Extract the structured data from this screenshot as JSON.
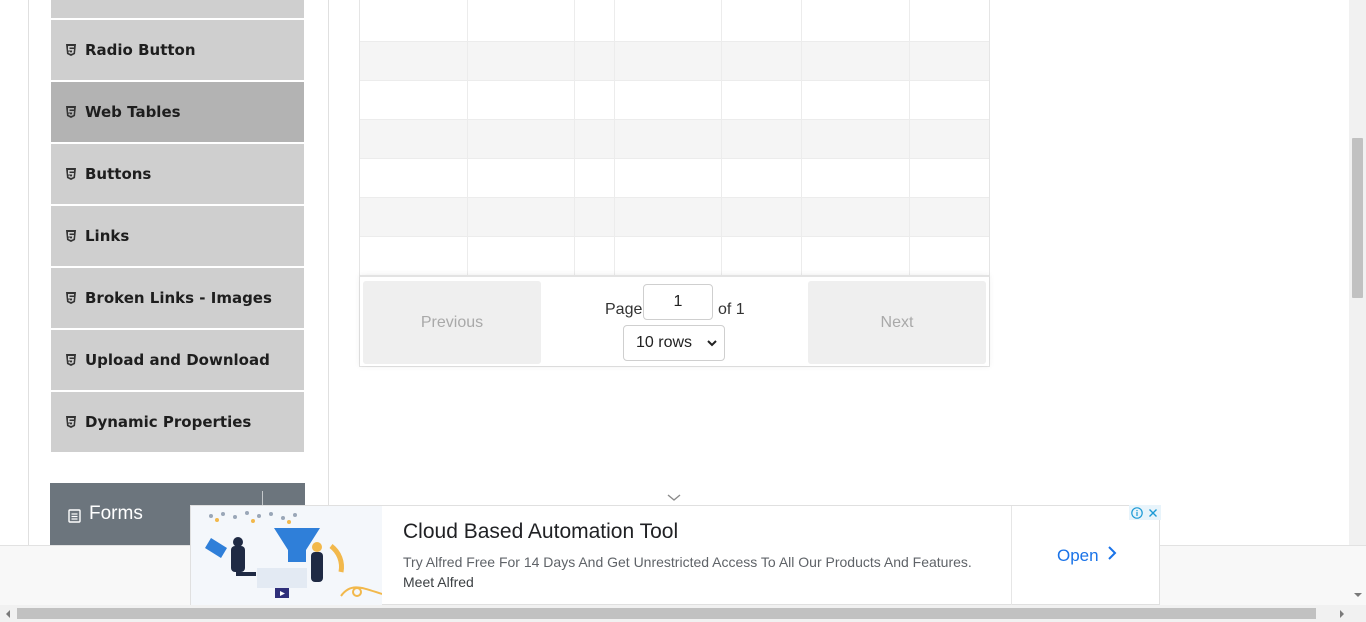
{
  "sidebar": {
    "items": [
      {
        "label": "",
        "state": "partial"
      },
      {
        "label": "Radio Button",
        "state": "normal"
      },
      {
        "label": "Web Tables",
        "state": "active"
      },
      {
        "label": "Buttons",
        "state": "normal"
      },
      {
        "label": "Links",
        "state": "normal"
      },
      {
        "label": "Broken Links - Images",
        "state": "normal"
      },
      {
        "label": "Upload and Download",
        "state": "normal"
      },
      {
        "label": "Dynamic Properties",
        "state": "normal"
      }
    ],
    "group_header": "Forms"
  },
  "table": {
    "empty_rows": 7,
    "pagination": {
      "previous_label": "Previous",
      "next_label": "Next",
      "page_label": "Page",
      "current_page": "1",
      "of_label": "of 1",
      "rows_select": "10 rows"
    }
  },
  "ad": {
    "title": "Cloud Based Automation Tool",
    "description": "Try Alfred Free For 14 Days And Get Unrestricted Access To All Our Products And Features.",
    "brand": "Meet Alfred",
    "cta_label": "Open"
  },
  "colors": {
    "menu_bg": "#cfcfcf",
    "menu_active_bg": "#b3b3b3",
    "group_header_bg": "#6c757d",
    "ad_cta": "#1a73e8"
  }
}
